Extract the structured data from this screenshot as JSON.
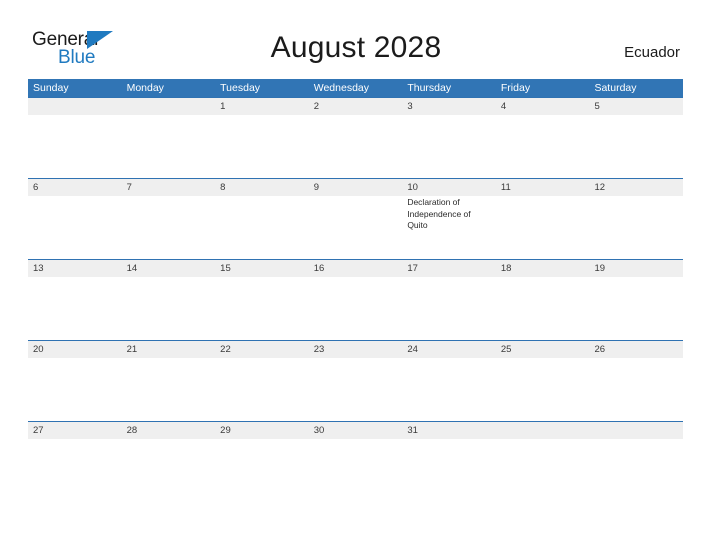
{
  "brand": {
    "name_part1": "General",
    "name_part2": "Blue",
    "flag_icon": "blue-pennant-icon",
    "accent_color": "#1f7ac0"
  },
  "header": {
    "title": "August 2028",
    "region": "Ecuador"
  },
  "calendar": {
    "month": "August",
    "year": "2028",
    "header_color": "#3175b5",
    "band_color": "#efefef",
    "weekdays": [
      "Sunday",
      "Monday",
      "Tuesday",
      "Wednesday",
      "Thursday",
      "Friday",
      "Saturday"
    ],
    "weeks": [
      [
        {
          "day": "",
          "event": ""
        },
        {
          "day": "",
          "event": ""
        },
        {
          "day": "1",
          "event": ""
        },
        {
          "day": "2",
          "event": ""
        },
        {
          "day": "3",
          "event": ""
        },
        {
          "day": "4",
          "event": ""
        },
        {
          "day": "5",
          "event": ""
        }
      ],
      [
        {
          "day": "6",
          "event": ""
        },
        {
          "day": "7",
          "event": ""
        },
        {
          "day": "8",
          "event": ""
        },
        {
          "day": "9",
          "event": ""
        },
        {
          "day": "10",
          "event": "Declaration of Independence of Quito"
        },
        {
          "day": "11",
          "event": ""
        },
        {
          "day": "12",
          "event": ""
        }
      ],
      [
        {
          "day": "13",
          "event": ""
        },
        {
          "day": "14",
          "event": ""
        },
        {
          "day": "15",
          "event": ""
        },
        {
          "day": "16",
          "event": ""
        },
        {
          "day": "17",
          "event": ""
        },
        {
          "day": "18",
          "event": ""
        },
        {
          "day": "19",
          "event": ""
        }
      ],
      [
        {
          "day": "20",
          "event": ""
        },
        {
          "day": "21",
          "event": ""
        },
        {
          "day": "22",
          "event": ""
        },
        {
          "day": "23",
          "event": ""
        },
        {
          "day": "24",
          "event": ""
        },
        {
          "day": "25",
          "event": ""
        },
        {
          "day": "26",
          "event": ""
        }
      ],
      [
        {
          "day": "27",
          "event": ""
        },
        {
          "day": "28",
          "event": ""
        },
        {
          "day": "29",
          "event": ""
        },
        {
          "day": "30",
          "event": ""
        },
        {
          "day": "31",
          "event": ""
        },
        {
          "day": "",
          "event": ""
        },
        {
          "day": "",
          "event": ""
        }
      ]
    ]
  }
}
